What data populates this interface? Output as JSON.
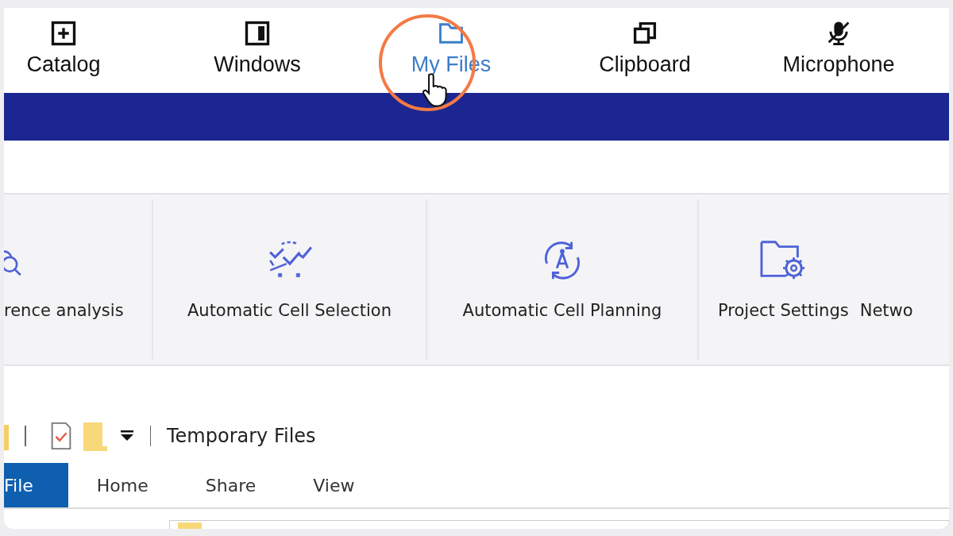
{
  "toolbar": {
    "items": [
      {
        "label": "Catalog",
        "kind": "plus-square",
        "selected": false
      },
      {
        "label": "Windows",
        "kind": "panel",
        "selected": false
      },
      {
        "label": "My Files",
        "kind": "folder",
        "selected": true
      },
      {
        "label": "Clipboard",
        "kind": "copy",
        "selected": false
      },
      {
        "label": "Microphone",
        "kind": "mic-off",
        "selected": false
      }
    ]
  },
  "ribbon": {
    "groups": [
      {
        "items": [
          {
            "label": "rence analysis",
            "kind": "search"
          }
        ]
      },
      {
        "items": [
          {
            "label": "Automatic Cell Selection",
            "kind": "cells"
          }
        ]
      },
      {
        "items": [
          {
            "label": "Automatic Cell Planning",
            "kind": "antenna"
          }
        ]
      },
      {
        "items": [
          {
            "label": "Project Settings",
            "kind": "folder-gear"
          },
          {
            "label": "Netwo",
            "kind": "text"
          }
        ]
      }
    ]
  },
  "explorer": {
    "title": "Temporary Files",
    "tabs": [
      {
        "label": "File",
        "selected": true
      },
      {
        "label": "Home",
        "selected": false
      },
      {
        "label": "Share",
        "selected": false
      },
      {
        "label": "View",
        "selected": false
      }
    ]
  }
}
